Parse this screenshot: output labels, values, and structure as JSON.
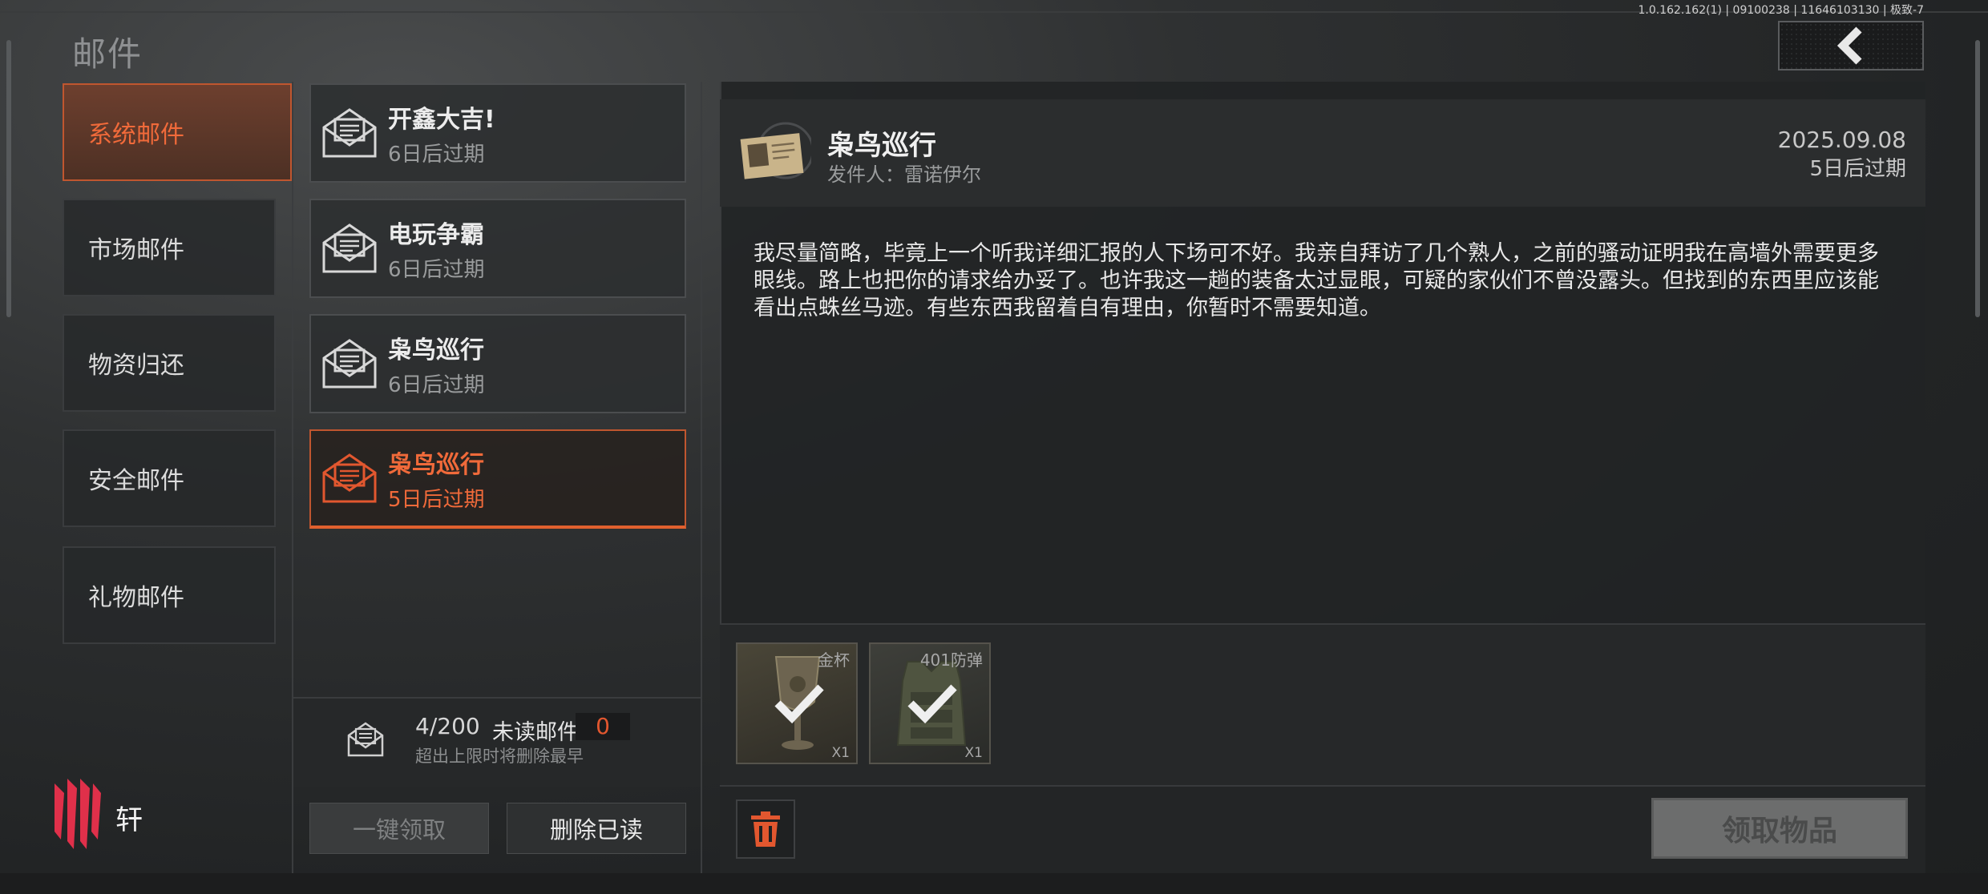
{
  "version": "1.0.162.162(1) | 09100238 | 11646103130 | 极致-7",
  "page_title": "邮件",
  "categories": [
    {
      "label": "系统邮件",
      "active": true
    },
    {
      "label": "市场邮件",
      "active": false
    },
    {
      "label": "物资归还",
      "active": false
    },
    {
      "label": "安全邮件",
      "active": false
    },
    {
      "label": "礼物邮件",
      "active": false
    }
  ],
  "mails": [
    {
      "title": "开鑫大吉!",
      "expiry": "6日后过期"
    },
    {
      "title": "电玩争霸",
      "expiry": "6日后过期"
    },
    {
      "title": "枭鸟巡行",
      "expiry": "6日后过期"
    },
    {
      "title": "枭鸟巡行",
      "expiry": "5日后过期"
    }
  ],
  "mailbox": {
    "count": "4/200",
    "unread_label": "未读邮件",
    "unread_count": "0",
    "overflow_note": "超出上限时将删除最早"
  },
  "actions": {
    "claim_all": "一键领取",
    "delete_read": "删除已读",
    "claim_items": "领取物品"
  },
  "detail": {
    "title": "枭鸟巡行",
    "sender": "发件人：雷诺伊尔",
    "date": "2025.09.08",
    "expiry": "5日后过期",
    "body": "我尽量简略，毕竟上一个听我详细汇报的人下场可不好。我亲自拜访了几个熟人，之前的骚动证明我在高墙外需要更多眼线。路上也把你的请求给办妥了。也许我这一趟的装备太过显眼，可疑的家伙们不曾没露头。但找到的东西里应该能看出点蛛丝马迹。有些东西我留着自有理由，你暂时不需要知道。"
  },
  "attachments": [
    {
      "name": "金杯",
      "qty": "X1",
      "icon": "gold-cup-icon"
    },
    {
      "name": "401防弹",
      "qty": "X1",
      "icon": "body-armor-icon"
    }
  ],
  "brand": {
    "name": "轩",
    "icon": "redmagic-logo-icon"
  },
  "colors": {
    "accent": "#e2572f",
    "background": "#2a2c2d"
  }
}
